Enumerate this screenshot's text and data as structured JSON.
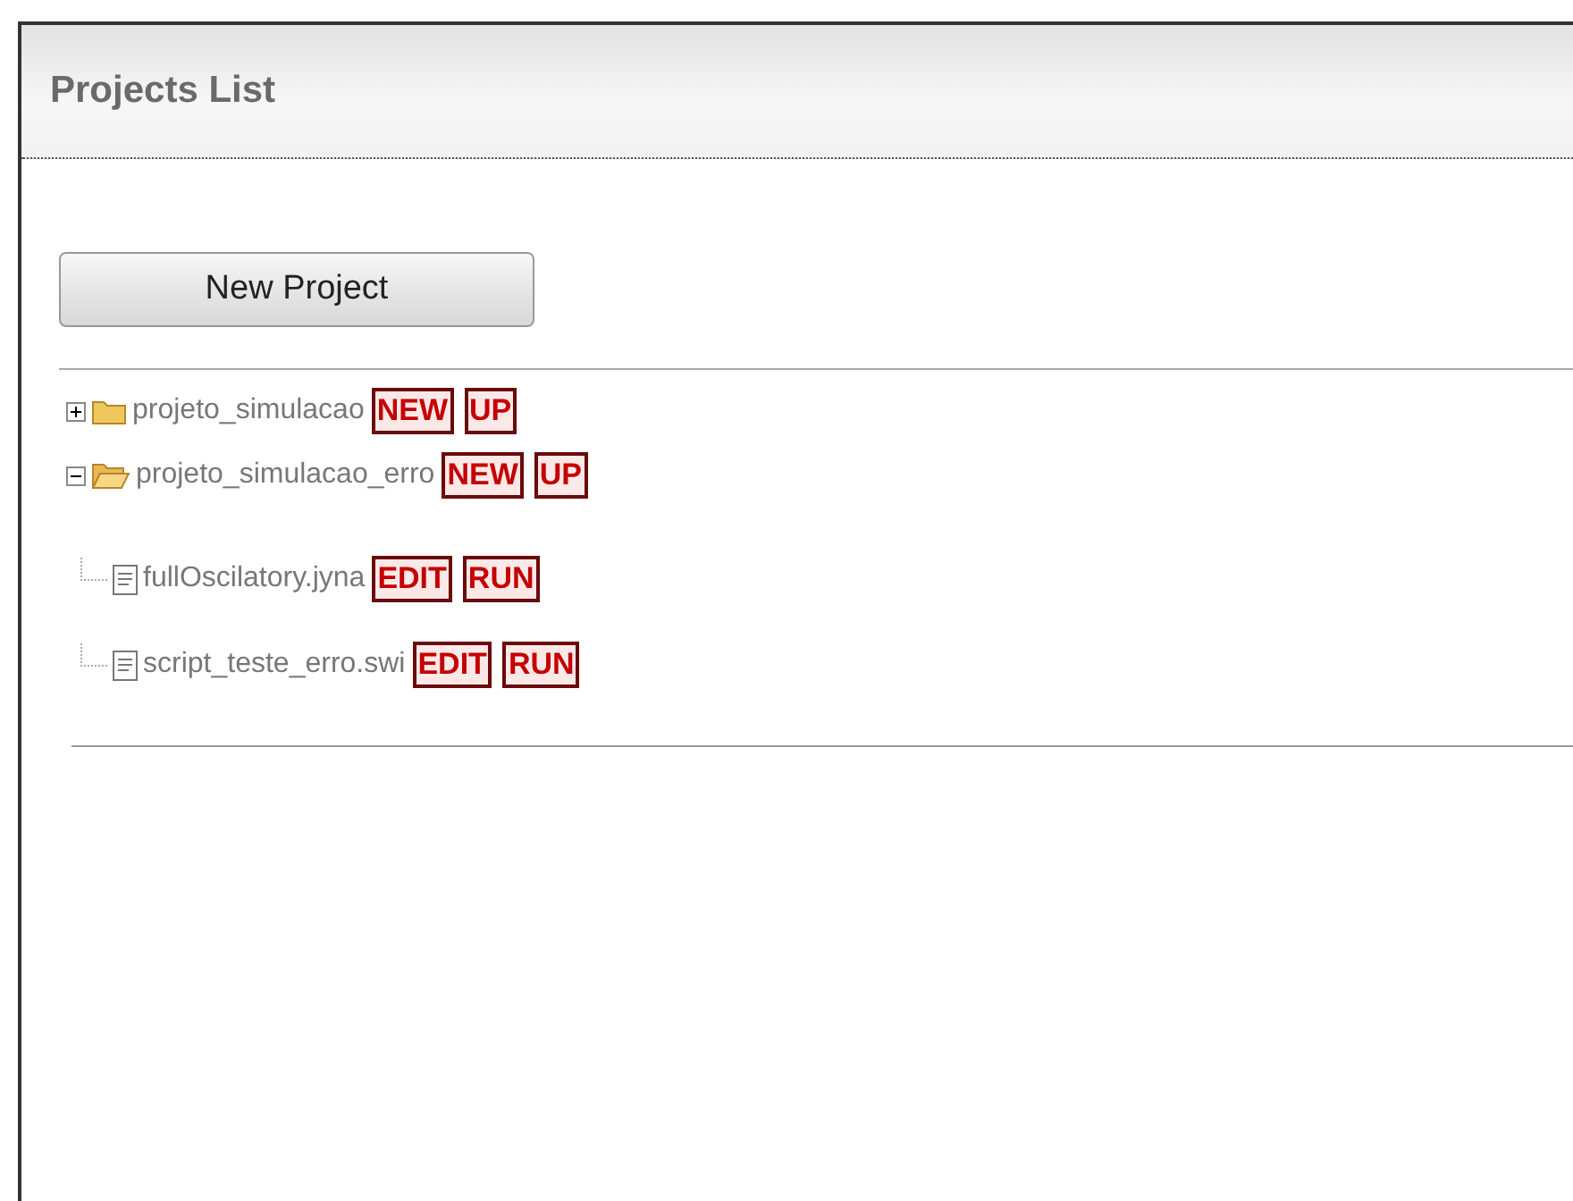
{
  "panel": {
    "title": "Projects List"
  },
  "new_project_button": "New Project",
  "tree": [
    {
      "kind": "folder",
      "label": "projeto_simulacao",
      "expanded": false,
      "actions": [
        "NEW",
        "UP"
      ]
    },
    {
      "kind": "folder",
      "label": "projeto_simulacao_erro",
      "expanded": true,
      "actions": [
        "NEW",
        "UP"
      ],
      "children": [
        {
          "kind": "file",
          "label": "fullOscilatory.jyna",
          "actions": [
            "EDIT",
            "RUN"
          ]
        },
        {
          "kind": "file",
          "label": "script_teste_erro.swi",
          "actions": [
            "EDIT",
            "RUN"
          ]
        }
      ]
    }
  ]
}
